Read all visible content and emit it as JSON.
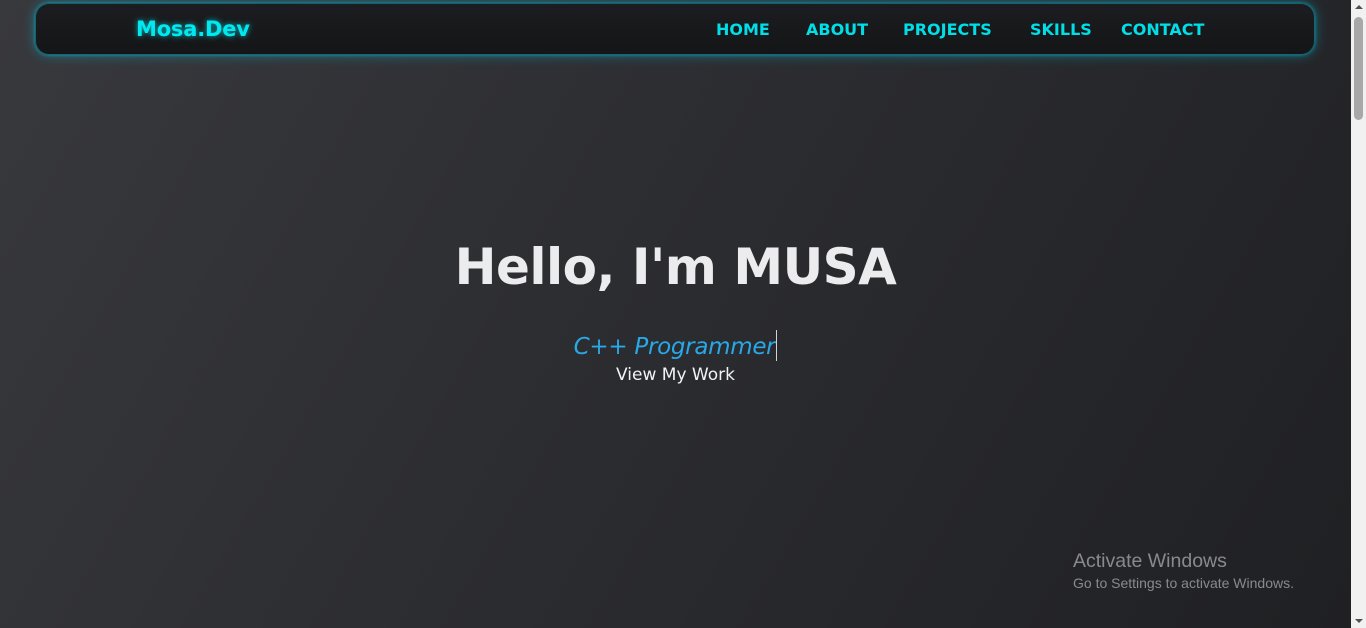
{
  "navbar": {
    "logo": "Mosa.Dev",
    "links": [
      {
        "label": "HOME"
      },
      {
        "label": "ABOUT"
      },
      {
        "label": "PROJECTS"
      },
      {
        "label": "SKILLS"
      },
      {
        "label": "CONTACT"
      }
    ]
  },
  "hero": {
    "title": "Hello, I'm MUSA",
    "typed_text": "C++ Programmer",
    "cta_label": "View My Work"
  },
  "watermark": {
    "title": "Activate Windows",
    "subtitle": "Go to Settings to activate Windows."
  },
  "colors": {
    "accent": "#00e8f0",
    "typed": "#29a8e8",
    "background": "#2c2d31"
  }
}
